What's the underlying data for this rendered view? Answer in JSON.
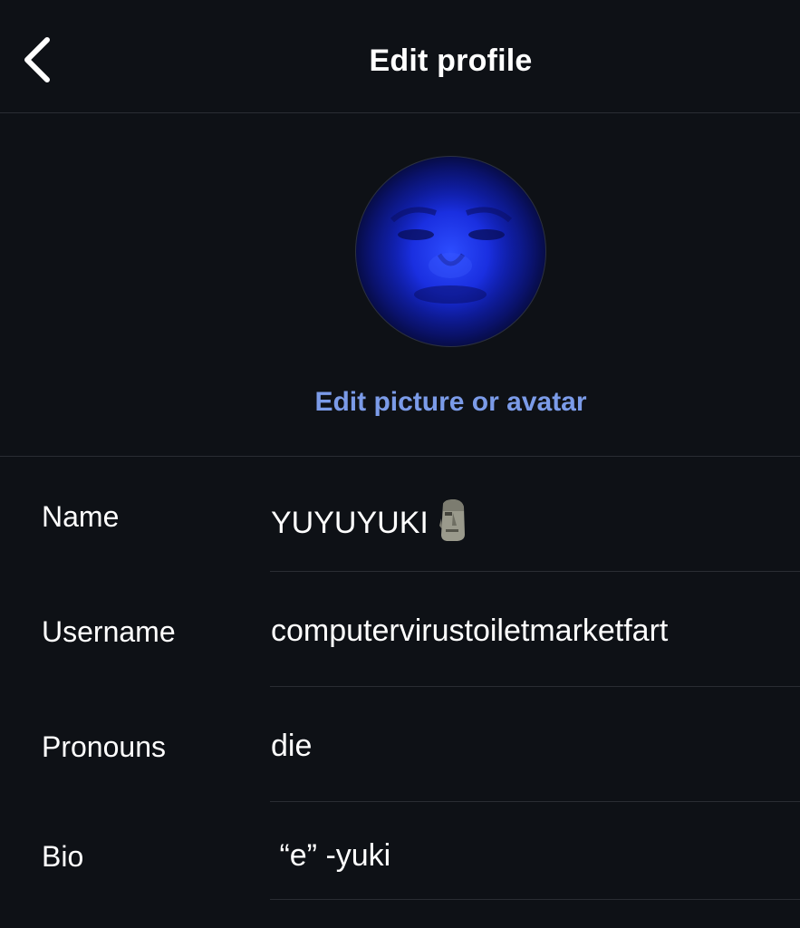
{
  "header": {
    "title": "Edit profile"
  },
  "avatar": {
    "edit_label": "Edit picture or avatar"
  },
  "fields": [
    {
      "label": "Name",
      "value": "YUYUYUKI",
      "emoji": "moai-icon"
    },
    {
      "label": "Username",
      "value": "computervirustoiletmarketfart"
    },
    {
      "label": "Pronouns",
      "value": "die"
    },
    {
      "label": "Bio",
      "value": " “e” -yuki"
    }
  ],
  "colors": {
    "background": "#0e1116",
    "link": "#7b9be8",
    "divider": "#2a2d33"
  }
}
